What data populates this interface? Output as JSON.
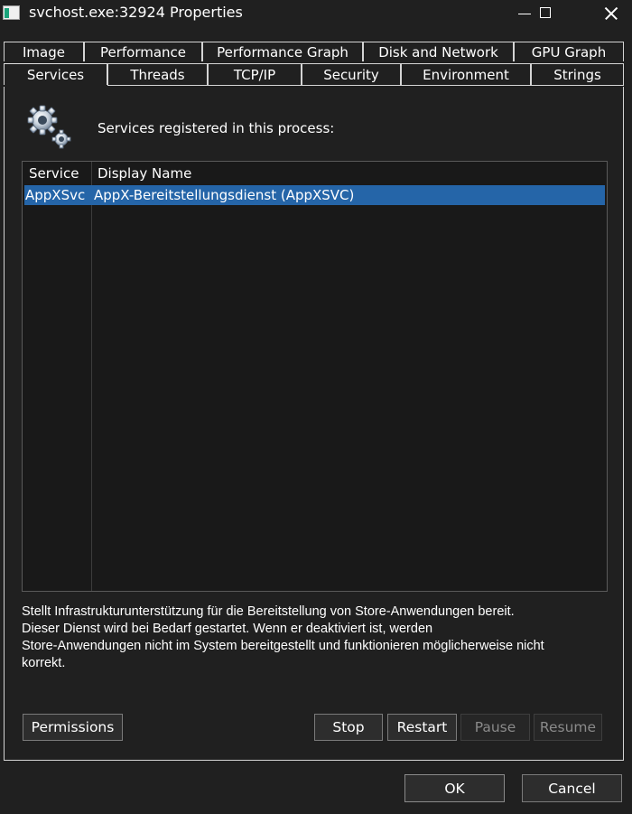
{
  "window": {
    "title": "svchost.exe:32924 Properties"
  },
  "tabs_row1": [
    {
      "label": "Image"
    },
    {
      "label": "Performance"
    },
    {
      "label": "Performance Graph"
    },
    {
      "label": "Disk and Network"
    },
    {
      "label": "GPU Graph"
    }
  ],
  "tabs_row2": [
    {
      "label": "Services",
      "active": true
    },
    {
      "label": "Threads"
    },
    {
      "label": "TCP/IP"
    },
    {
      "label": "Security"
    },
    {
      "label": "Environment"
    },
    {
      "label": "Strings"
    }
  ],
  "services": {
    "heading": "Services registered in this process:",
    "icon": "gears-icon",
    "columns": [
      "Service",
      "Display Name"
    ],
    "rows": [
      {
        "service": "AppXSvc",
        "display_name": "AppX-Bereitstellungsdienst (AppXSVC)",
        "selected": true
      }
    ],
    "description": [
      "Stellt Infrastrukturunterstützung für die Bereitstellung von Store-Anwendungen bereit.",
      "Dieser Dienst wird bei Bedarf gestartet. Wenn er deaktiviert ist, werden",
      "Store-Anwendungen nicht im System bereitgestellt und funktionieren möglicherweise nicht",
      "korrekt."
    ]
  },
  "buttons": {
    "permissions": "Permissions",
    "stop": "Stop",
    "restart": "Restart",
    "pause": "Pause",
    "resume": "Resume",
    "ok": "OK",
    "cancel": "Cancel"
  },
  "colors": {
    "background": "#202020",
    "selection": "#2565a8"
  }
}
